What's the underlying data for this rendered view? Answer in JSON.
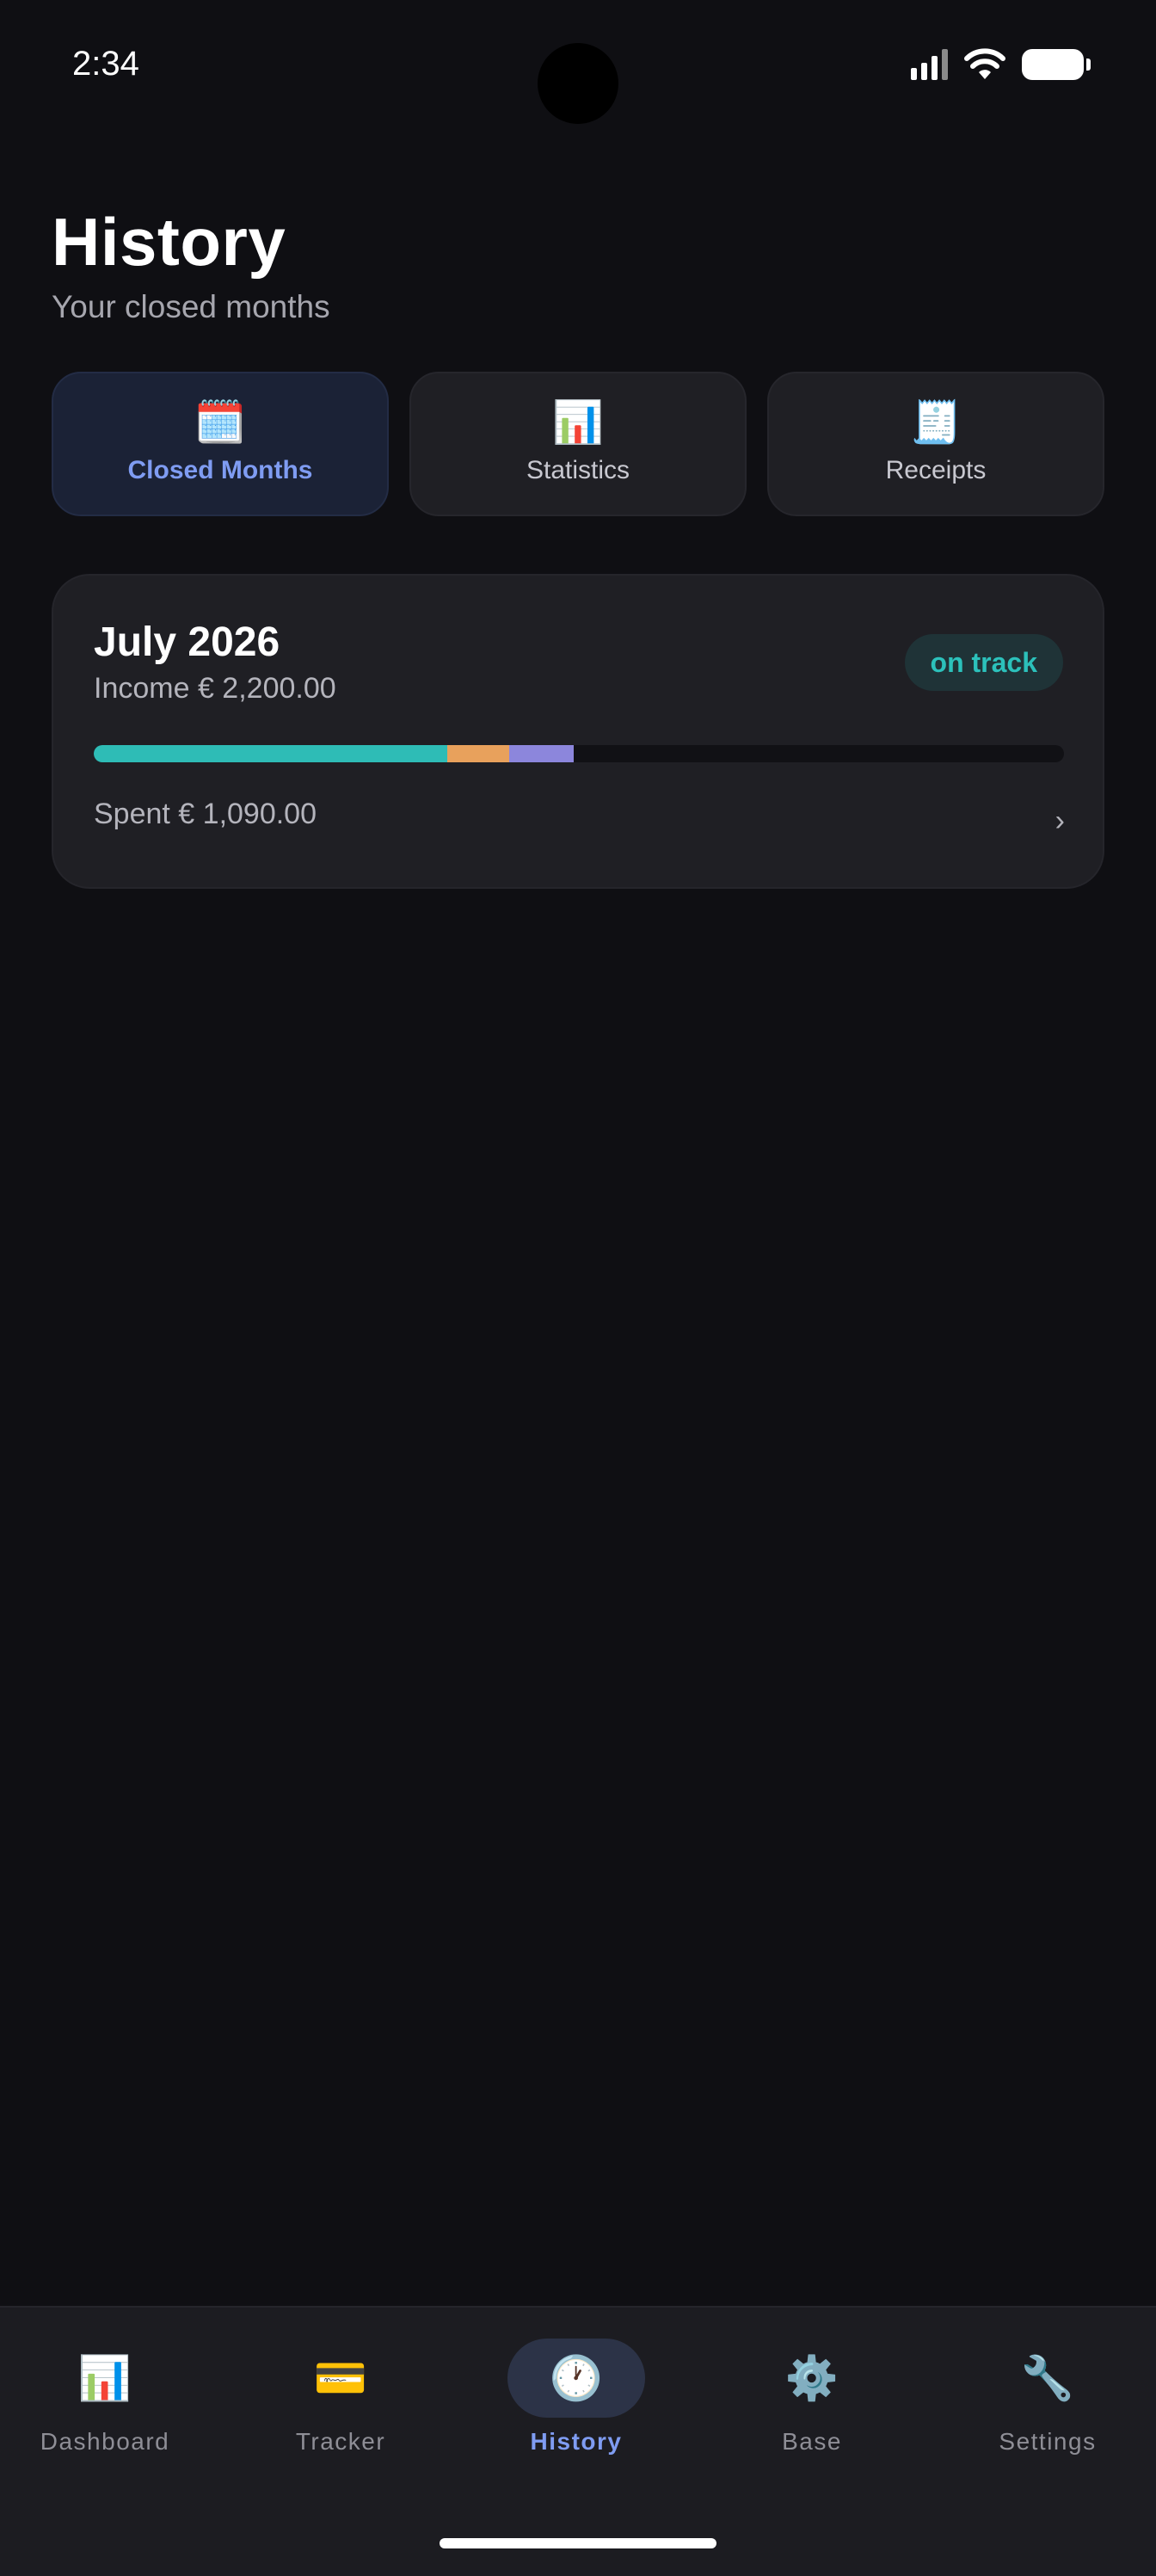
{
  "status_bar": {
    "time": "2:34"
  },
  "header": {
    "title": "History",
    "subtitle": "Your closed months"
  },
  "tabs": [
    {
      "icon": "calendar-icon",
      "glyph": "🗓️",
      "label": "Closed Months",
      "active": true
    },
    {
      "icon": "bar-chart-icon",
      "glyph": "📊",
      "label": "Statistics",
      "active": false
    },
    {
      "icon": "receipt-icon",
      "glyph": "🧾",
      "label": "Receipts",
      "active": false
    }
  ],
  "month_card": {
    "title": "July 2026",
    "income": "Income € 2,200.00",
    "status": "on track",
    "spent": "Spent € 1,090.00",
    "chevron": "›",
    "progress_segments": [
      {
        "fraction": 0.364,
        "color": "#2ebcb6"
      },
      {
        "fraction": 0.064,
        "color": "#e8a15c"
      },
      {
        "fraction": 0.067,
        "color": "#8c86dc"
      }
    ]
  },
  "bottom_nav": [
    {
      "icon": "dashboard-icon",
      "glyph": "📊",
      "label": "Dashboard",
      "active": false
    },
    {
      "icon": "credit-card-icon",
      "glyph": "💳",
      "label": "Tracker",
      "active": false
    },
    {
      "icon": "clock-icon",
      "glyph": "🕐",
      "label": "History",
      "active": true
    },
    {
      "icon": "gear-icon",
      "glyph": "⚙️",
      "label": "Base",
      "active": false
    },
    {
      "icon": "wrench-icon",
      "glyph": "🔧",
      "label": "Settings",
      "active": false
    }
  ],
  "colors": {
    "background": "#0f0f13",
    "card": "#1f1f24",
    "accent": "#7f9cf2",
    "badge_text": "#2cc1bb"
  }
}
